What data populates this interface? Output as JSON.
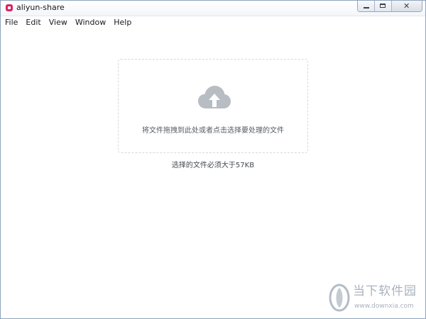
{
  "window": {
    "title": "aliyun-share",
    "controls": {
      "minimize": "minimize",
      "maximize": "maximize",
      "close": "✕"
    }
  },
  "menu": {
    "items": [
      {
        "label": "File"
      },
      {
        "label": "Edit"
      },
      {
        "label": "View"
      },
      {
        "label": "Window"
      },
      {
        "label": "Help"
      }
    ]
  },
  "upload": {
    "icon": "cloud-upload-icon",
    "drop_text": "将文件拖拽到此处或者点击选择要处理的文件",
    "hint_text": "选择的文件必须大于57KB"
  },
  "watermark": {
    "name": "当下软件园",
    "url": "www.downxia.com"
  },
  "colors": {
    "accent_icon": "#b8bcc3",
    "app_icon": "#d9265f",
    "watermark": "#a9b2bd"
  }
}
